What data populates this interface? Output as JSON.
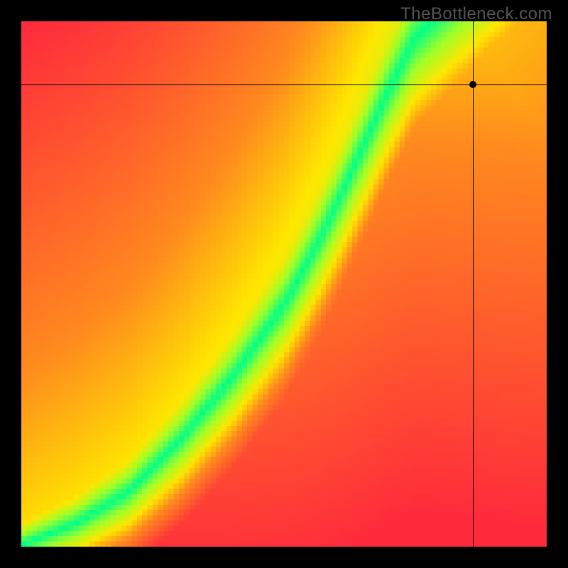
{
  "watermark": "TheBottleneck.com",
  "chart_data": {
    "type": "heatmap",
    "title": "",
    "xlabel": "",
    "ylabel": "",
    "xlim": [
      0,
      100
    ],
    "ylim": [
      0,
      100
    ],
    "grid": false,
    "legend": false,
    "marker": {
      "x": 86,
      "y": 88
    },
    "crosshair": {
      "x": 86,
      "y": 88
    },
    "color_scale": [
      {
        "value": 0,
        "color": "#ff2a3c"
      },
      {
        "value": 40,
        "color": "#ff8a1e"
      },
      {
        "value": 60,
        "color": "#ffe600"
      },
      {
        "value": 80,
        "color": "#9eff29"
      },
      {
        "value": 100,
        "color": "#00ff88"
      }
    ],
    "optimal_curve": [
      {
        "x": 0,
        "y": 0
      },
      {
        "x": 10,
        "y": 4
      },
      {
        "x": 20,
        "y": 10
      },
      {
        "x": 30,
        "y": 20
      },
      {
        "x": 40,
        "y": 32
      },
      {
        "x": 50,
        "y": 46
      },
      {
        "x": 55,
        "y": 55
      },
      {
        "x": 60,
        "y": 65
      },
      {
        "x": 65,
        "y": 76
      },
      {
        "x": 70,
        "y": 87
      },
      {
        "x": 75,
        "y": 97
      },
      {
        "x": 78,
        "y": 100
      }
    ],
    "grid_resolution": 100
  }
}
